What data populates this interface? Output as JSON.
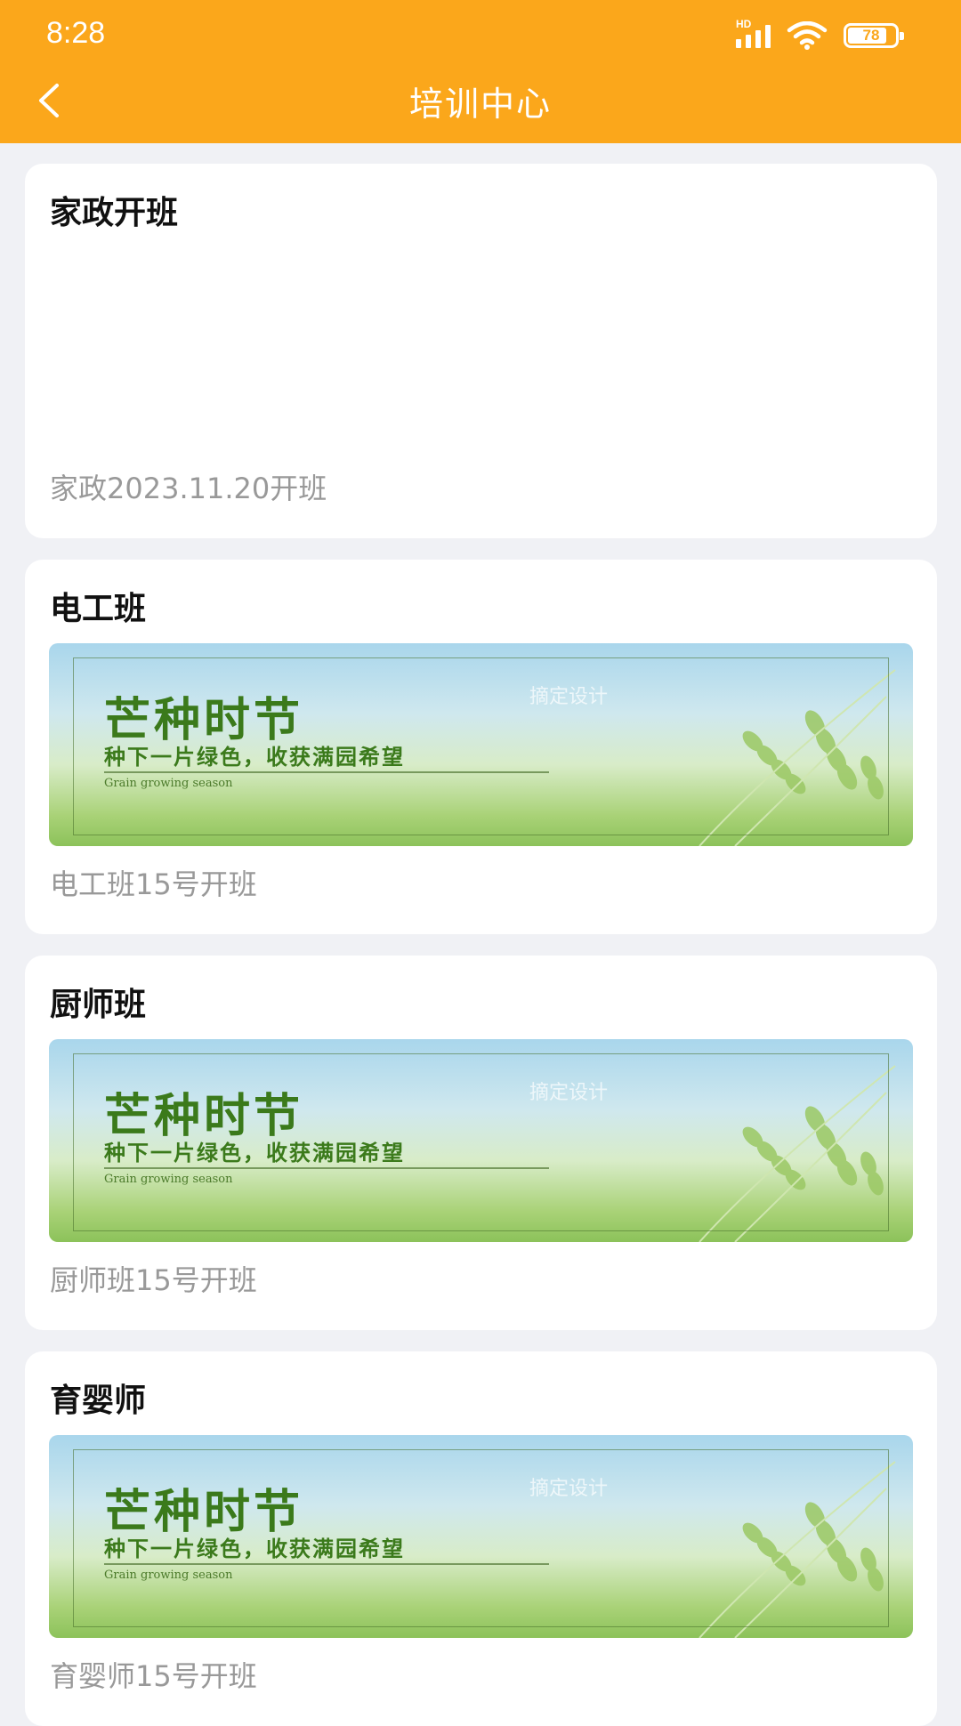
{
  "status_bar": {
    "time": "8:28",
    "network": "HD",
    "battery": "78"
  },
  "nav": {
    "title": "培训中心",
    "back_icon": "chevron-left-icon"
  },
  "colors": {
    "header": "#fba71b",
    "background": "#f0f1f5",
    "card": "#ffffff",
    "subtitle": "#999999"
  },
  "banner": {
    "title": "芒种时节",
    "slogan": "种下一片绿色，收获满园希望",
    "english": "Grain growing season",
    "watermark": "摘定设计"
  },
  "courses": [
    {
      "title": "家政开班",
      "subtitle": "家政2023.11.20开班",
      "has_image": false
    },
    {
      "title": "电工班",
      "subtitle": "电工班15号开班",
      "has_image": true
    },
    {
      "title": "厨师班",
      "subtitle": "厨师班15号开班",
      "has_image": true
    },
    {
      "title": "育婴师",
      "subtitle": "育婴师15号开班",
      "has_image": true
    }
  ]
}
